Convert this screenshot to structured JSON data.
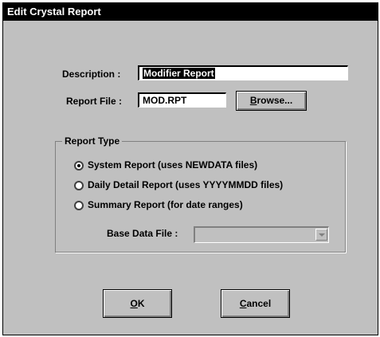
{
  "window": {
    "title": "Edit Crystal Report"
  },
  "description": {
    "label": "Description :",
    "value": "Modifier Report"
  },
  "report_file": {
    "label": "Report File :",
    "value": "MOD.RPT"
  },
  "browse_button": {
    "underlined": "B",
    "rest": "rowse..."
  },
  "report_type": {
    "title": "Report Type",
    "options": [
      {
        "label": "System Report (uses NEWDATA files)",
        "checked": true
      },
      {
        "label": "Daily Detail Report (uses YYYYMMDD files)",
        "checked": false
      },
      {
        "label": "Summary Report (for date ranges)",
        "checked": false
      }
    ],
    "base_data_file": {
      "label": "Base Data File :",
      "value": "",
      "enabled": false
    }
  },
  "ok_button": {
    "underlined": "O",
    "rest": "K"
  },
  "cancel_button": {
    "underlined": "C",
    "rest": "ancel"
  }
}
